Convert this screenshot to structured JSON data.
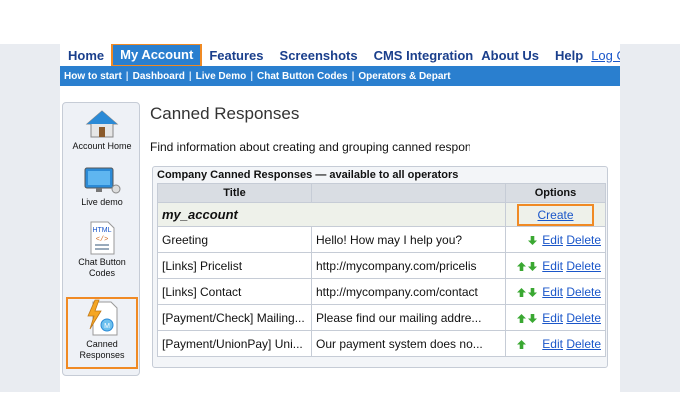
{
  "topnav": {
    "home": "Home",
    "my_account": "My Account",
    "features": "Features",
    "screenshots": "Screenshots",
    "cms": "CMS Integration",
    "about": "About Us",
    "help": "Help",
    "logout": "Log Out"
  },
  "subnav": {
    "how_to_start": "How to start",
    "dashboard": "Dashboard",
    "live_demo": "Live Demo",
    "chat_button_codes": "Chat Button Codes",
    "operators": "Operators & Depart"
  },
  "sidebar": {
    "items": [
      {
        "label": "Account Home",
        "icon": "house-icon"
      },
      {
        "label": "Live demo",
        "icon": "monitor-icon"
      },
      {
        "label": "Chat Button Codes",
        "icon": "html-file-icon"
      },
      {
        "label": "Canned Responses",
        "icon": "lightning-document-icon"
      }
    ]
  },
  "content": {
    "title": "Canned Responses",
    "intro": "Find information about creating and grouping canned respons"
  },
  "panel": {
    "header": "Company Canned Responses — available to all operators",
    "col_title": "Title",
    "col_options": "Options",
    "group_name": "my_account",
    "create_label": "Create",
    "rows": [
      {
        "title": "Greeting",
        "text": "Hello! How may I help you?",
        "up": false,
        "down": true
      },
      {
        "title": "[Links] Pricelist",
        "text": "http://mycompany.com/pricelis",
        "up": true,
        "down": true
      },
      {
        "title": "[Links] Contact",
        "text": "http://mycompany.com/contact",
        "up": true,
        "down": true
      },
      {
        "title": "[Payment/Check] Mailing...",
        "text": "Please find our mailing addre...",
        "up": true,
        "down": true
      },
      {
        "title": "[Payment/UnionPay] Uni...",
        "text": "Our payment system does no...",
        "up": true,
        "down": false
      }
    ],
    "edit_label": "Edit",
    "delete_label": "Delete"
  },
  "colors": {
    "nav_blue": "#2a7fcf",
    "highlight_orange": "#f08a24",
    "link_blue": "#1a56c9",
    "arrow_green": "#3aa832"
  }
}
